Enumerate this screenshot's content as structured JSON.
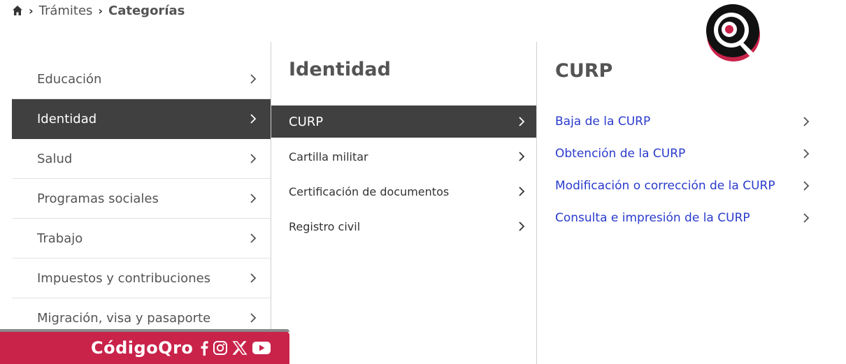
{
  "breadcrumb": {
    "items": [
      "Trámites",
      "Categorías"
    ]
  },
  "categories": {
    "items": [
      {
        "label": "Educación",
        "active": false
      },
      {
        "label": "Identidad",
        "active": true
      },
      {
        "label": "Salud",
        "active": false
      },
      {
        "label": "Programas sociales",
        "active": false
      },
      {
        "label": "Trabajo",
        "active": false
      },
      {
        "label": "Impuestos y contribuciones",
        "active": false
      },
      {
        "label": "Migración, visa y pasaporte",
        "active": false
      }
    ]
  },
  "subcategory": {
    "title": "Identidad",
    "items": [
      {
        "label": "CURP",
        "active": true
      },
      {
        "label": "Cartilla militar",
        "active": false
      },
      {
        "label": "Certificación de documentos",
        "active": false
      },
      {
        "label": "Registro civil",
        "active": false
      }
    ]
  },
  "procedures": {
    "title": "CURP",
    "items": [
      {
        "label": "Baja de la CURP"
      },
      {
        "label": "Obtención de la CURP"
      },
      {
        "label": "Modificación o corrección de la CURP"
      },
      {
        "label": "Consulta e impresión de la CURP"
      }
    ]
  },
  "brand": {
    "name": "CódigoQro",
    "social_icons": [
      "facebook-icon",
      "instagram-icon",
      "x-icon",
      "youtube-icon"
    ]
  },
  "colors": {
    "active_bg": "#404041",
    "link": "#2a3bcc",
    "brand": "#c9234a"
  }
}
